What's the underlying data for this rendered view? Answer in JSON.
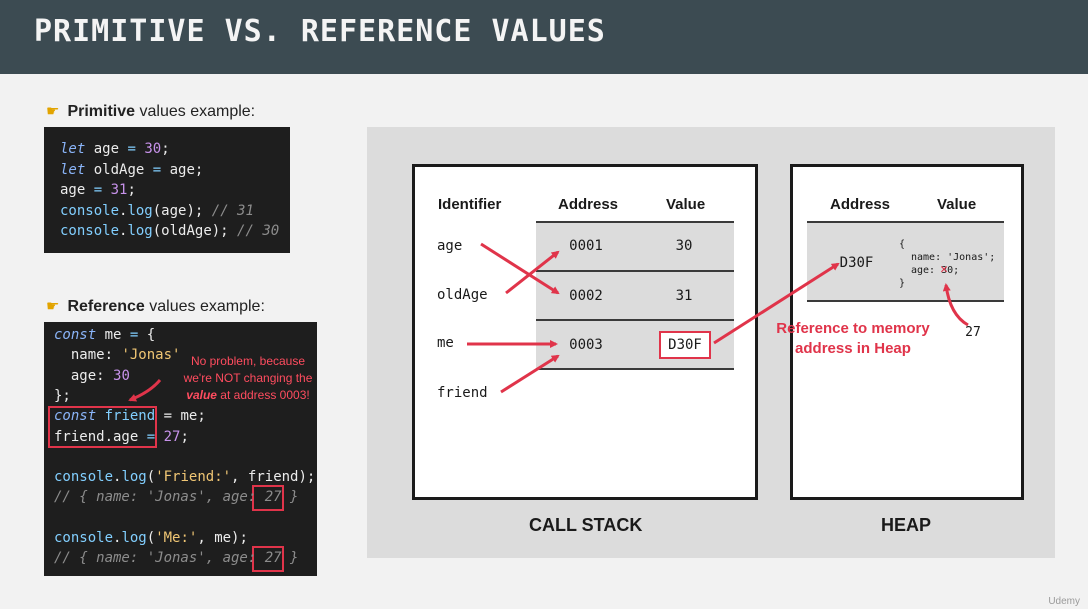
{
  "slide": {
    "title": "PRIMITIVE VS. REFERENCE VALUES",
    "watermark": "Udemy"
  },
  "primitive": {
    "heading_bold": "Primitive",
    "heading_rest": " values example:",
    "code": [
      [
        {
          "t": "let",
          "c": "kw"
        },
        {
          "t": " age "
        },
        {
          "t": "=",
          "c": "fn"
        },
        {
          "t": " "
        },
        {
          "t": "30",
          "c": "num"
        },
        {
          "t": ";"
        }
      ],
      [
        {
          "t": "let",
          "c": "kw"
        },
        {
          "t": " oldAge "
        },
        {
          "t": "=",
          "c": "fn"
        },
        {
          "t": " age;"
        }
      ],
      [
        {
          "t": "age "
        },
        {
          "t": "=",
          "c": "fn"
        },
        {
          "t": " "
        },
        {
          "t": "31",
          "c": "num"
        },
        {
          "t": ";"
        }
      ],
      [
        {
          "t": "console",
          "c": "fn"
        },
        {
          "t": "."
        },
        {
          "t": "log",
          "c": "fn"
        },
        {
          "t": "(age); "
        },
        {
          "t": "// 31",
          "c": "cmt"
        }
      ],
      [
        {
          "t": "console",
          "c": "fn"
        },
        {
          "t": "."
        },
        {
          "t": "log",
          "c": "fn"
        },
        {
          "t": "(oldAge); "
        },
        {
          "t": "// 30",
          "c": "cmt"
        }
      ]
    ]
  },
  "reference": {
    "heading_bold": "Reference",
    "heading_rest": " values example:",
    "code": [
      [
        {
          "t": "const",
          "c": "kw"
        },
        {
          "t": " me "
        },
        {
          "t": "=",
          "c": "fn"
        },
        {
          "t": " {"
        }
      ],
      [
        {
          "t": "  name: "
        },
        {
          "t": "'Jonas'",
          "c": "str"
        }
      ],
      [
        {
          "t": "  age: "
        },
        {
          "t": "30",
          "c": "num"
        }
      ],
      [
        {
          "t": "};"
        }
      ],
      [
        {
          "t": "const",
          "c": "kw"
        },
        {
          "t": " friend ",
          "c": "fn"
        },
        {
          "t": "="
        },
        {
          "t": " me;"
        }
      ],
      [
        {
          "t": "friend.age "
        },
        {
          "t": "=",
          "c": "fn"
        },
        {
          "t": " "
        },
        {
          "t": "27",
          "c": "num"
        },
        {
          "t": ";"
        }
      ],
      [],
      [
        {
          "t": "console",
          "c": "fn"
        },
        {
          "t": "."
        },
        {
          "t": "log",
          "c": "fn"
        },
        {
          "t": "("
        },
        {
          "t": "'Friend:'",
          "c": "str"
        },
        {
          "t": ", friend);"
        }
      ],
      [
        {
          "t": "// { name: 'Jonas', age: 27 }",
          "c": "cmt"
        }
      ],
      [],
      [
        {
          "t": "console",
          "c": "fn"
        },
        {
          "t": "."
        },
        {
          "t": "log",
          "c": "fn"
        },
        {
          "t": "("
        },
        {
          "t": "'Me:'",
          "c": "str"
        },
        {
          "t": ", me);"
        }
      ],
      [
        {
          "t": "// { name: 'Jonas', age: 27 }",
          "c": "cmt"
        }
      ]
    ],
    "note_line1": "No problem, because",
    "note_line2": "we're NOT changing the",
    "note_line3_em": "value",
    "note_line3_rest": " at address 0003!"
  },
  "call_stack": {
    "caption": "CALL STACK",
    "headers": {
      "identifier": "Identifier",
      "address": "Address",
      "value": "Value"
    },
    "identifiers": [
      "age",
      "oldAge",
      "me",
      "friend"
    ],
    "rows": [
      {
        "address": "0001",
        "value": "30"
      },
      {
        "address": "0002",
        "value": "31"
      },
      {
        "address": "0003",
        "value": "D30F"
      }
    ]
  },
  "heap": {
    "caption": "HEAP",
    "headers": {
      "address": "Address",
      "value": "Value"
    },
    "address": "D30F",
    "object_open": "{",
    "object_name": "name: 'Jonas';",
    "object_age_key": "age: ",
    "object_age_old": "30",
    "object_age_end": ";",
    "object_close": "}",
    "new_value": "27"
  },
  "annotation": {
    "line1": "Reference to memory",
    "line2": "address in Heap"
  },
  "colors": {
    "header_bg": "#3c4b52",
    "accent_red": "#e0344a",
    "code_bg": "#1e1e1e"
  }
}
